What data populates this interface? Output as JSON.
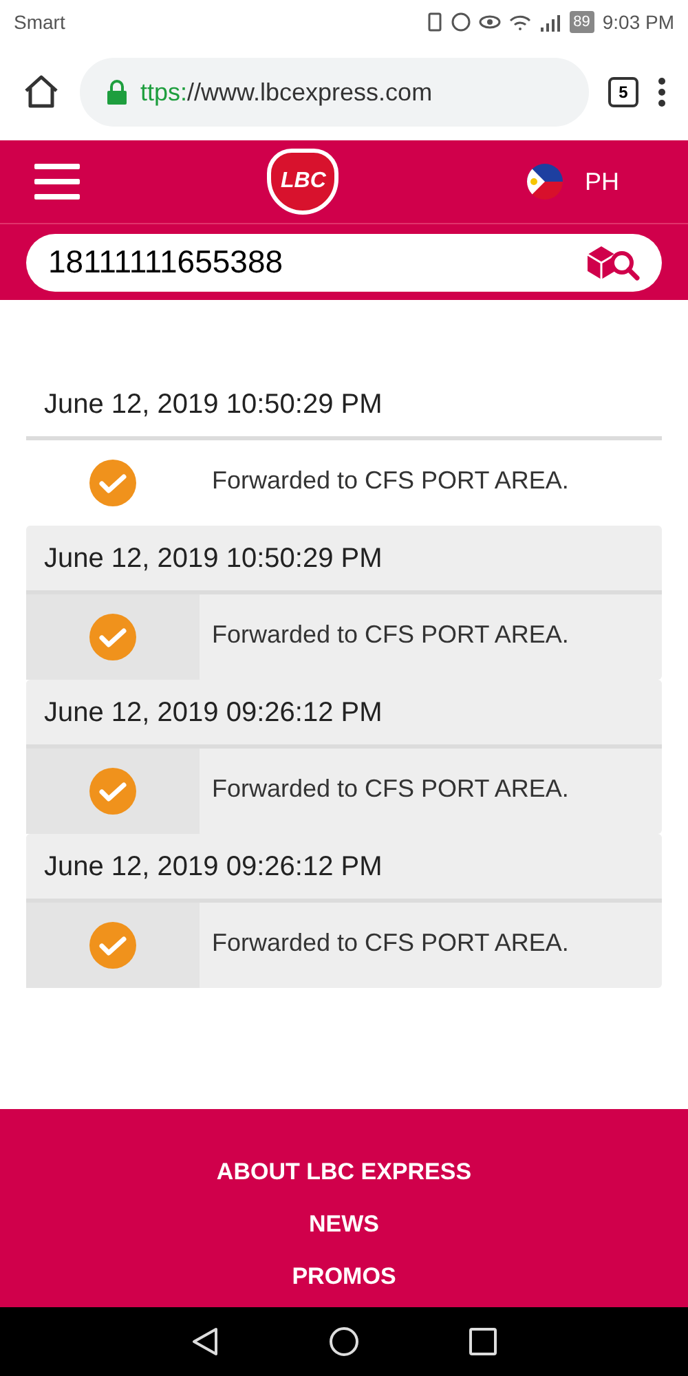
{
  "status_bar": {
    "carrier": "Smart",
    "battery": "89",
    "time": "9:03 PM"
  },
  "browser": {
    "url_scheme": "ttps:",
    "url_rest": "//www.lbcexpress.com",
    "tab_count": "5"
  },
  "header": {
    "logo": "LBC",
    "country": "PH"
  },
  "search": {
    "value": "18111111655388"
  },
  "tracking": [
    {
      "datetime": "June 12, 2019 10:50:29 PM",
      "status": "Forwarded to CFS PORT AREA.",
      "shaded": false
    },
    {
      "datetime": "June 12, 2019 10:50:29 PM",
      "status": "Forwarded to CFS PORT AREA.",
      "shaded": true
    },
    {
      "datetime": "June 12, 2019 09:26:12 PM",
      "status": "Forwarded to CFS PORT AREA.",
      "shaded": true
    },
    {
      "datetime": "June 12, 2019 09:26:12 PM",
      "status": "Forwarded to CFS PORT AREA.",
      "shaded": true
    }
  ],
  "footer_links": [
    "ABOUT LBC EXPRESS",
    "NEWS",
    "PROMOS"
  ]
}
